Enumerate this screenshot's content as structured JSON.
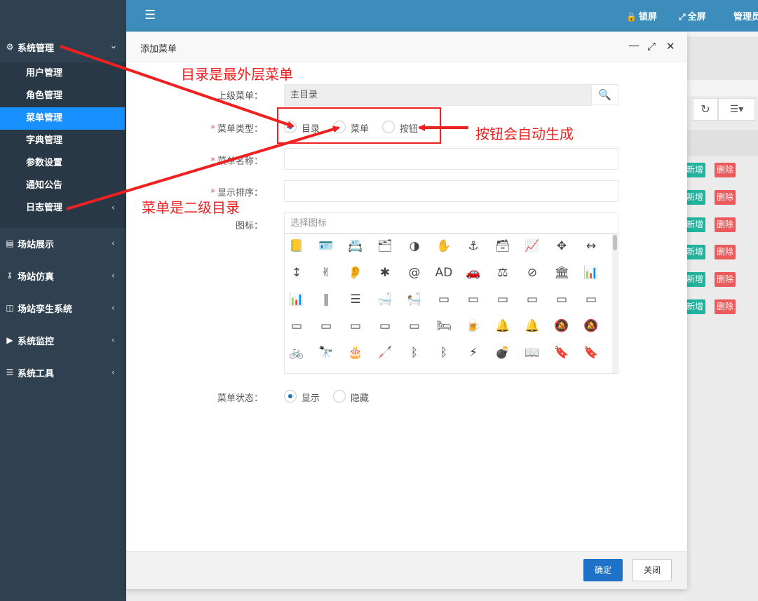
{
  "topbar": {
    "lock_label": "锁屏",
    "fullscreen_label": "全屏",
    "admin_label": "管理员"
  },
  "sidebar": {
    "groups": [
      {
        "label": "系统管理",
        "icon": "gear-icon"
      },
      {
        "label": "场站展示",
        "icon": "monitor-icon"
      },
      {
        "label": "场站仿真",
        "icon": "share-icon"
      },
      {
        "label": "场站孪生系统",
        "icon": "sitemap-icon"
      },
      {
        "label": "系统监控",
        "icon": "video-icon"
      },
      {
        "label": "系统工具",
        "icon": "bars-icon"
      }
    ],
    "items": [
      {
        "label": "用户管理"
      },
      {
        "label": "角色管理"
      },
      {
        "label": "菜单管理",
        "active": true
      },
      {
        "label": "字典管理"
      },
      {
        "label": "参数设置"
      },
      {
        "label": "通知公告"
      },
      {
        "label": "日志管理"
      }
    ]
  },
  "background_table": {
    "add_label": "新增",
    "delete_label": "删除"
  },
  "dialog": {
    "title": "添加菜单",
    "fields": {
      "parent": {
        "label": "上级菜单：",
        "value": "主目录"
      },
      "menu_type": {
        "label": "菜单类型：",
        "options": [
          "目录",
          "菜单",
          "按钮"
        ],
        "selected": "目录"
      },
      "menu_name": {
        "label": "菜单名称：",
        "value": ""
      },
      "order": {
        "label": "显示排序：",
        "value": ""
      },
      "icon": {
        "label": "图标：",
        "placeholder": "选择图标"
      },
      "status": {
        "label": "菜单状态：",
        "options": [
          "显示",
          "隐藏"
        ],
        "selected": "显示"
      }
    },
    "ok_label": "确定",
    "close_label": "关闭"
  },
  "icon_grid": [
    [
      "address-book-icon",
      "address-card-icon",
      "id-card-icon",
      "id-card-o-icon",
      "adjust-icon",
      "american-sign-language-icon",
      "anchor-icon",
      "archive-icon",
      "area-chart-icon",
      "arrows-icon",
      "arrows-h-icon"
    ],
    [
      "arrows-v-icon",
      "sign-language-icon",
      "deaf-icon",
      "asterisk-icon",
      "at-icon",
      "audio-description-icon",
      "car-icon",
      "balance-scale-icon",
      "ban-icon",
      "bank-icon",
      "bar-chart-icon"
    ],
    [
      "bar-chart-o-icon",
      "barcode-icon",
      "bars-icon",
      "bath-icon",
      "bathtub-icon",
      "battery-full-icon",
      "battery-empty-icon",
      "battery-quarter-icon",
      "battery-half-icon",
      "battery-three-quarters-icon",
      "battery-icon"
    ],
    [
      "battery-0-icon",
      "battery-3-icon",
      "battery-2-icon",
      "battery-1-icon",
      "battery-4-icon",
      "bed-icon",
      "beer-icon",
      "bell-icon",
      "bell-o-icon",
      "bell-slash-icon",
      "bell-slash-o-icon"
    ],
    [
      "bicycle-icon",
      "binoculars-icon",
      "birthday-cake-icon",
      "blind-icon",
      "bluetooth-icon",
      "bluetooth-b-icon",
      "bolt-icon",
      "bomb-icon",
      "book-icon",
      "bookmark-icon",
      "bookmark-o-icon"
    ]
  ],
  "annotations": {
    "directory_note": "目录是最外层菜单",
    "menu_note": "菜单是二级目录",
    "button_note": "按钮会自动生成"
  }
}
